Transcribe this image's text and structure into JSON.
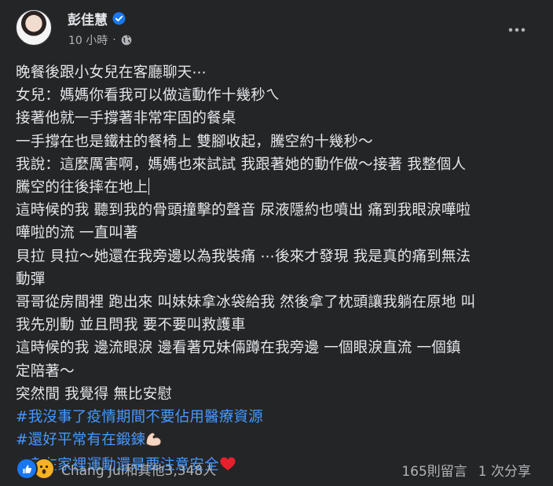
{
  "post": {
    "author": "彭佳慧",
    "time": "10 小時",
    "separator": "·",
    "lines": [
      "晚餐後跟小女兒在客廳聊天⋯",
      "女兒：媽媽你看我可以做這動作十幾秒ㄟ",
      "接著他就一手撐著非常牢固的餐桌",
      "一手撐在也是鐵柱的餐椅上 雙腳收起，騰空約十幾秒～",
      "我說：這麼厲害啊，媽媽也來試試 我跟著她的動作做～接著 我整個人",
      "騰空的往後摔在地上",
      "這時候的我 聽到我的骨頭撞擊的聲音 尿液隱約也噴出 痛到我眼淚嘩啦",
      "嘩啦的流 一直叫著",
      "貝拉 貝拉～她還在我旁邊以為我裝痛 ⋯後來才發現 我是真的痛到無法",
      "動彈",
      "哥哥從房間裡 跑出來 叫妹妹拿冰袋給我 然後拿了枕頭讓我躺在原地 叫",
      "我先別動 並且問我 要不要叫救護車",
      "這時候的我 邊流眼淚 邊看著兄妹倆蹲在我旁邊 一個眼淚直流  一個鎮",
      "定陪著～",
      "突然間 我覺得 無比安慰"
    ],
    "hashtags": [
      "#我沒事了疫情期間不要佔用醫療資源",
      "#還好平常有在鍛鍊",
      "#宅在家裡運動還是要注意安全"
    ]
  },
  "footer": {
    "reactions_text": "Chang Jui和其他3,348人",
    "comments": "165則留言",
    "shares": "1 次分享"
  },
  "colors": {
    "background": "#242526",
    "text": "#e4e6eb",
    "secondary": "#b0b3b8",
    "hashtag": "#4599ff",
    "verified": "#1877f2"
  },
  "icons": [
    "avatar",
    "verified-badge-icon",
    "globe-icon",
    "more-options-icon",
    "flexed-biceps-emoji",
    "red-heart-emoji",
    "like-reaction-icon",
    "wow-reaction-icon"
  ]
}
